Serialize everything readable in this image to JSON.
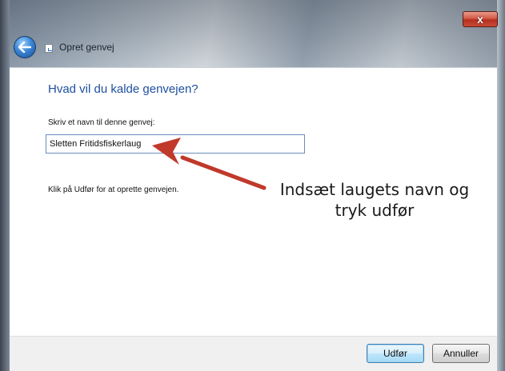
{
  "window": {
    "title": "Opret genvej",
    "close_label": "x"
  },
  "content": {
    "heading": "Hvad vil du kalde genvejen?",
    "field_label": "Skriv et navn til denne genvej:",
    "name_value": "Sletten Fritidsfiskerlaug",
    "instruction": "Klik på Udfør for at oprette genvejen."
  },
  "annotation": {
    "line1": "Indsæt laugets navn og",
    "line2": "tryk udfør",
    "arrow_color": "#c0392b"
  },
  "buttons": {
    "finish_label": "Udfør",
    "cancel_label": "Annuller"
  },
  "icons": {
    "back": "back-arrow-icon",
    "wizard": "shortcut-wizard-icon",
    "close": "close-icon"
  }
}
